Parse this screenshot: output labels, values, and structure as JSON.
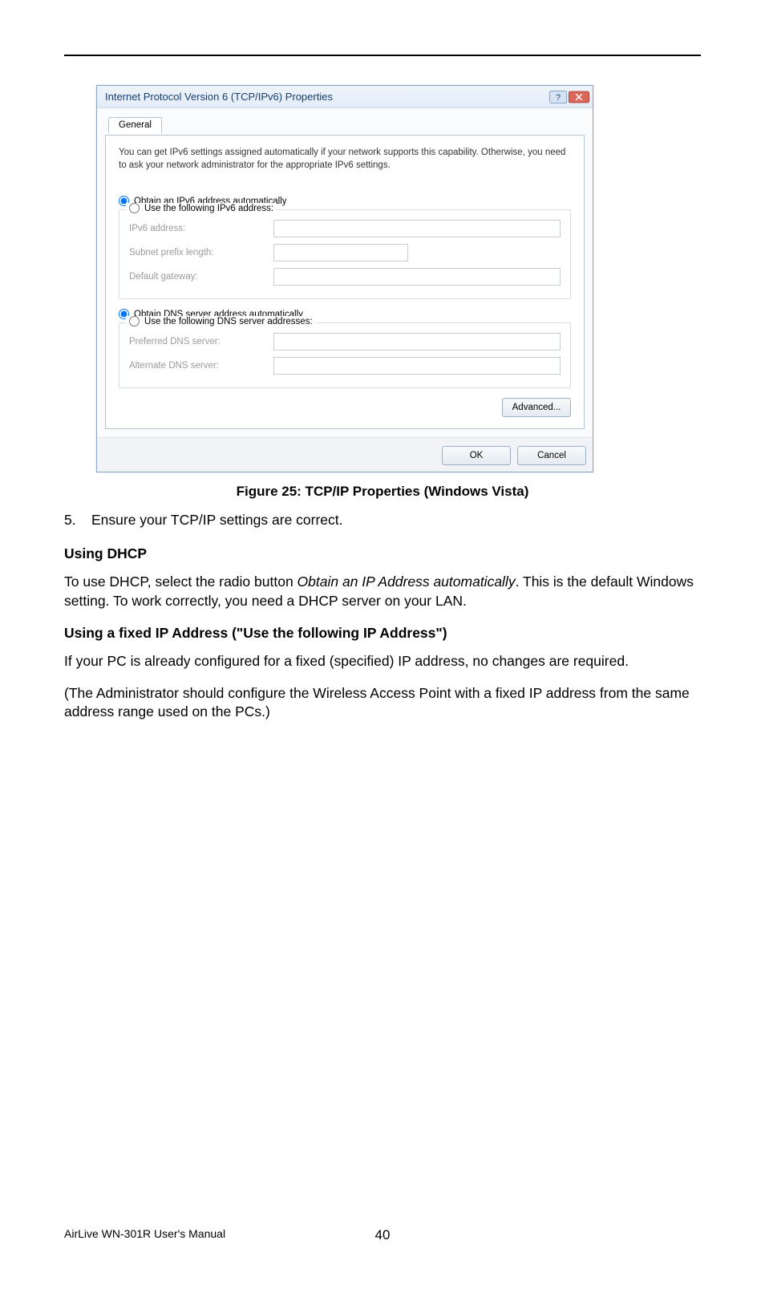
{
  "dialog": {
    "title": "Internet Protocol Version 6 (TCP/IPv6) Properties",
    "tab": "General",
    "intro": "You can get IPv6 settings assigned automatically if your network supports this capability. Otherwise, you need to ask your network administrator for the appropriate IPv6 settings.",
    "radio_ip_auto": "Obtain an IPv6 address automatically",
    "radio_ip_manual": "Use the following IPv6 address:",
    "label_ipv6_address": "IPv6 address:",
    "label_prefix": "Subnet prefix length:",
    "label_gateway": "Default gateway:",
    "radio_dns_auto": "Obtain DNS server address automatically",
    "radio_dns_manual": "Use the following DNS server addresses:",
    "label_pref_dns": "Preferred DNS server:",
    "label_alt_dns": "Alternate DNS server:",
    "btn_advanced": "Advanced...",
    "btn_ok": "OK",
    "btn_cancel": "Cancel"
  },
  "figure_caption": "Figure 25: TCP/IP Properties (Windows Vista)",
  "step5_num": "5.",
  "step5_text": "Ensure your TCP/IP settings are correct.",
  "h_dhcp": "Using DHCP",
  "p_dhcp_a": "To use DHCP, select the radio button ",
  "p_dhcp_italic": "Obtain an IP Address automatically",
  "p_dhcp_b": ". This is the default Windows setting. To work correctly, you need a DHCP server on your LAN.",
  "h_fixed": "Using a fixed IP Address (\"Use the following IP Address\")",
  "p_fixed": "If your PC is already configured for a fixed (specified) IP address, no changes are required.",
  "p_admin": "(The Administrator should configure the Wireless Access Point with a fixed IP address from the same address range used on the PCs.)",
  "footer_left": "AirLive WN-301R User's Manual",
  "footer_page": "40"
}
